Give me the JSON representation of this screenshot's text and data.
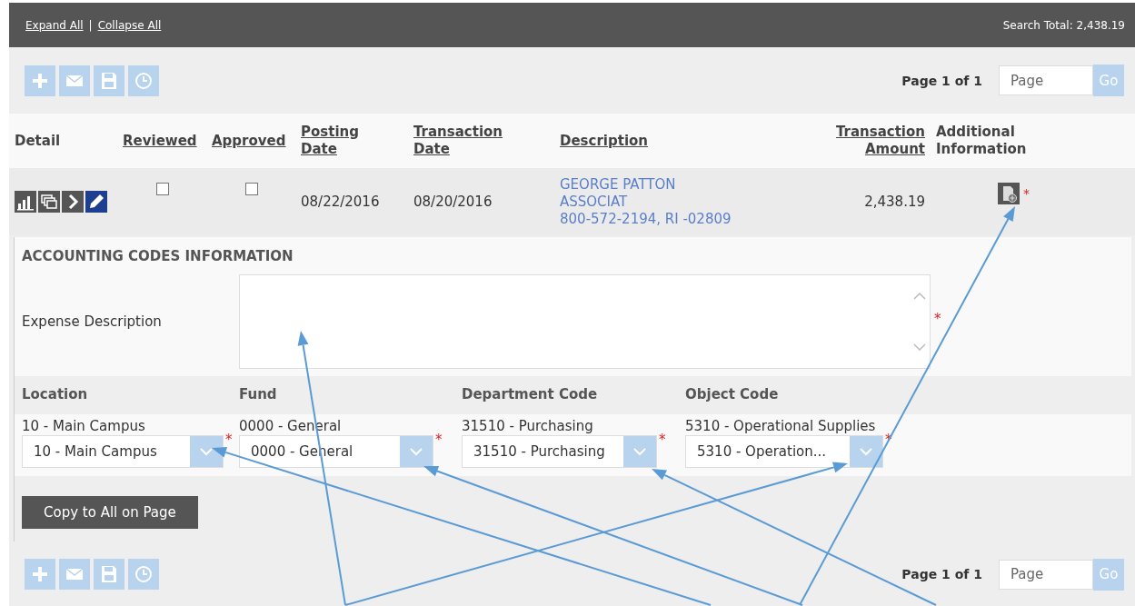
{
  "header": {
    "links": [
      "Expand All",
      "Collapse All"
    ],
    "separator": "|",
    "search_total": "Search Total: 2,438.19"
  },
  "toolbar_top": {
    "buttons": [
      {
        "kind": "add"
      },
      {
        "kind": "email"
      },
      {
        "kind": "save"
      },
      {
        "kind": "history"
      }
    ],
    "page_label": "Page 1 of 1",
    "page_field": {
      "placeholder": "Page"
    },
    "go_button": "Go"
  },
  "table": {
    "columns": [
      {
        "label": "Detail",
        "sortable": false
      },
      {
        "label": "Reviewed",
        "sortable": true
      },
      {
        "label": "Approved",
        "sortable": true
      },
      {
        "label": "Posting Date",
        "sortable": true
      },
      {
        "label": "Transaction Date",
        "sortable": true
      },
      {
        "label": "Description",
        "sortable": true
      },
      {
        "label": "Transaction Amount",
        "sortable": true
      },
      {
        "label": "Additional Information",
        "sortable": false
      }
    ],
    "rows": [
      {
        "detail_icons": [
          {
            "kind": "chart"
          },
          {
            "kind": "copy"
          },
          {
            "kind": "expand"
          },
          {
            "kind": "edit"
          }
        ],
        "reviewed": false,
        "approved": false,
        "posting_date": "08/22/2016",
        "transaction_date": "08/20/2016",
        "description": [
          "GEORGE PATTON",
          "ASSOCIAT",
          "800-572-2194, RI -02809"
        ],
        "amount": "2,438.19",
        "required_mark": "*"
      }
    ]
  },
  "accounting": {
    "title": "ACCOUNTING CODES INFORMATION",
    "expense_description": {
      "label": "Expense Description",
      "required_mark": "*"
    },
    "fields": [
      {
        "label": "Location",
        "current": "10 - Main Campus",
        "value": "10 - Main Campus",
        "required_mark": "*"
      },
      {
        "label": "Fund",
        "current": "0000 - General",
        "value": "0000 - General",
        "required_mark": "*"
      },
      {
        "label": "Department Code",
        "current": "31510 - Purchasing",
        "value": "31510 - Purchasing",
        "required_mark": "*"
      },
      {
        "label": "Object Code",
        "current": "5310 - Operational Supplies",
        "value": "5310 - Operation...",
        "required_mark": "*"
      }
    ],
    "copy_button": "Copy to All on Page"
  },
  "toolbar_bottom": {
    "buttons": [
      {
        "kind": "add"
      },
      {
        "kind": "email"
      },
      {
        "kind": "save"
      },
      {
        "kind": "history"
      }
    ],
    "page_label": "Page 1 of 1",
    "page_field": {
      "placeholder": "Page"
    },
    "go_button": "Go"
  },
  "annotation_arrows": [
    {
      "kind": "arrow"
    },
    {
      "kind": "arrow"
    },
    {
      "kind": "arrow"
    },
    {
      "kind": "arrow"
    },
    {
      "kind": "arrow"
    },
    {
      "kind": "arrow"
    }
  ]
}
